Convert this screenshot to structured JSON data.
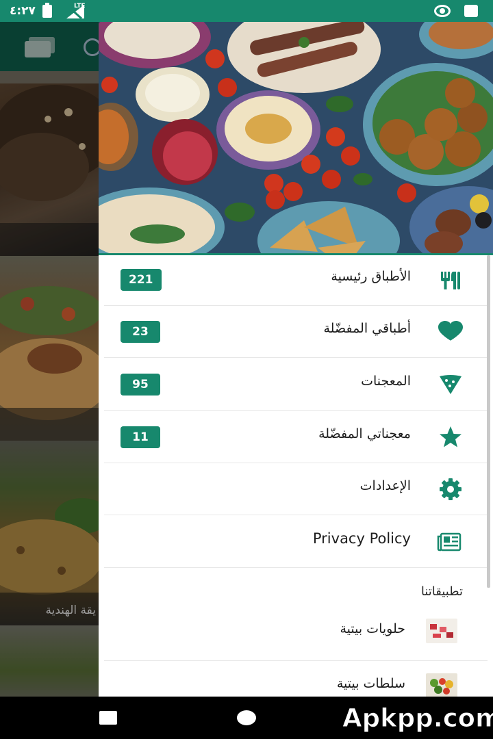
{
  "status_bar": {
    "time": "٤:٢٧",
    "network": "LTE"
  },
  "background_app": {
    "card_title": "يقة الهندية"
  },
  "drawer": {
    "menu": [
      {
        "label": "الأطباق رئيسية",
        "badge": "221",
        "icon": "fork-knife-icon"
      },
      {
        "label": "أطباقي المفضّلة",
        "badge": "23",
        "icon": "heart-icon"
      },
      {
        "label": "المعجنات",
        "badge": "95",
        "icon": "pastry-icon"
      },
      {
        "label": "معجناتي المفضّلة",
        "badge": "11",
        "icon": "star-icon"
      },
      {
        "label": "الإعدادات",
        "badge": "",
        "icon": "gear-icon"
      },
      {
        "label": "Privacy Policy",
        "badge": "",
        "icon": "newspaper-icon"
      }
    ],
    "apps_section_title": "تطبيقاتنا",
    "apps": [
      {
        "label": "حلويات بيتية",
        "icon": "sweets-thumb"
      },
      {
        "label": "سلطات بيتية",
        "icon": "salads-thumb"
      }
    ]
  },
  "colors": {
    "accent": "#17886d",
    "toolbar": "#0d5443",
    "header_bg": "#2d4a67"
  },
  "watermark": "Apkpp.com"
}
